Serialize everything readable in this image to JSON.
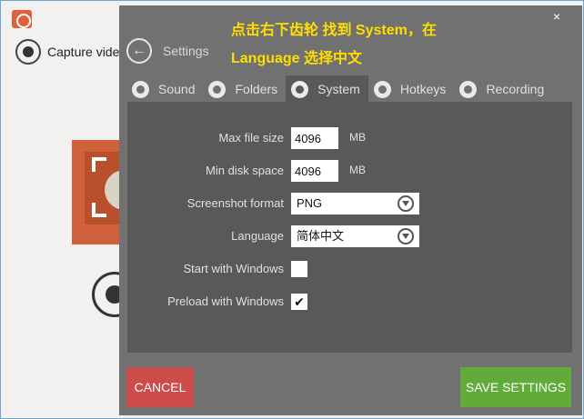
{
  "background": {
    "capture_label": "Capture video"
  },
  "dialog": {
    "title": "Settings",
    "close_label": "×",
    "annotation_line1": "点击右下齿轮 找到 System，在",
    "annotation_line2": "Language 选择中文",
    "tabs": [
      {
        "label": "Sound",
        "icon": "speaker-icon",
        "active": false
      },
      {
        "label": "Folders",
        "icon": "folder-icon",
        "active": false
      },
      {
        "label": "System",
        "icon": "gear-icon",
        "active": true
      },
      {
        "label": "Hotkeys",
        "icon": "keyboard-icon",
        "active": false
      },
      {
        "label": "Recording",
        "icon": "record-icon",
        "active": false
      }
    ],
    "fields": {
      "max_file_size": {
        "label": "Max file size",
        "value": "4096",
        "unit": "MB"
      },
      "min_disk_space": {
        "label": "Min disk space",
        "value": "4096",
        "unit": "MB"
      },
      "screenshot_format": {
        "label": "Screenshot format",
        "value": "PNG"
      },
      "language": {
        "label": "Language",
        "value": "简体中文"
      },
      "start_with_windows": {
        "label": "Start with Windows",
        "checked": false
      },
      "preload_with_windows": {
        "label": "Preload with Windows",
        "checked": true,
        "mark": "✔"
      }
    },
    "cancel_label": "CANCEL",
    "save_label": "SAVE SETTINGS"
  },
  "colors": {
    "dialog_bg": "#717171",
    "panel_bg": "#595959",
    "cancel": "#cc4b4b",
    "save": "#61ab3b",
    "annotation": "#ffde00"
  }
}
